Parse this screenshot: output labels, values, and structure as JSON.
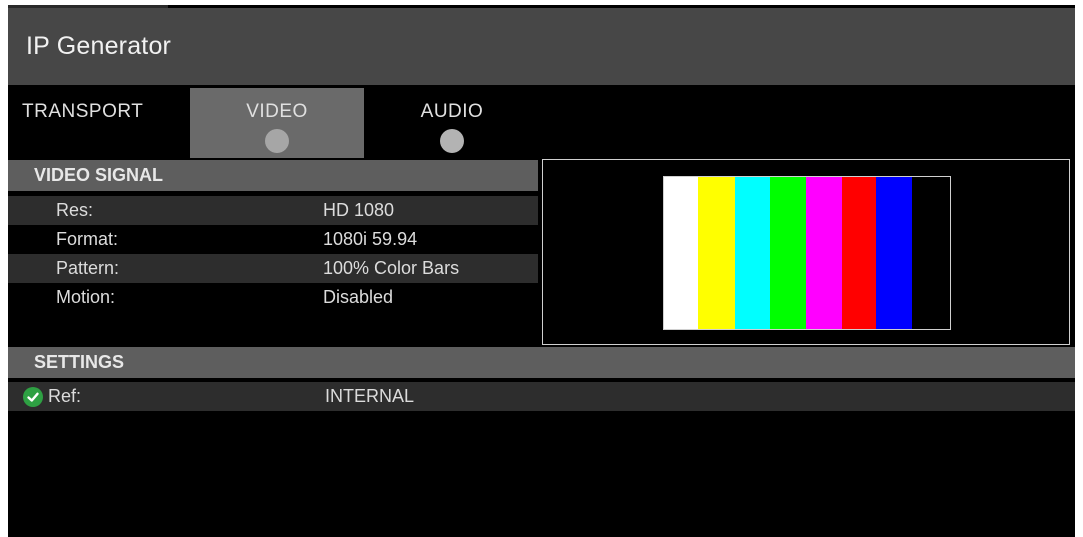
{
  "window": {
    "title": "IP Generator"
  },
  "tabs": [
    {
      "label": "TRANSPORT",
      "active": false,
      "has_indicator": false
    },
    {
      "label": "VIDEO",
      "active": true,
      "has_indicator": true
    },
    {
      "label": "AUDIO",
      "active": false,
      "has_indicator": true
    }
  ],
  "video_signal": {
    "header": "VIDEO SIGNAL",
    "rows": [
      {
        "label": "Res:",
        "value": "HD 1080"
      },
      {
        "label": "Format:",
        "value": "1080i 59.94"
      },
      {
        "label": "Pattern:",
        "value": "100% Color Bars"
      },
      {
        "label": "Motion:",
        "value": "Disabled"
      }
    ]
  },
  "preview": {
    "pattern_name": "color-bars",
    "bar_colors": [
      "#ffffff",
      "#ffff00",
      "#00ffff",
      "#00ff00",
      "#ff00ff",
      "#ff0000",
      "#0000ff",
      "#000000"
    ]
  },
  "settings": {
    "header": "SETTINGS",
    "rows": [
      {
        "label": "Ref:",
        "value": "INTERNAL",
        "status_icon": "check-circle-icon",
        "status_color": "#2ea043"
      }
    ]
  },
  "colors": {
    "titlebar": "#474747",
    "active_tab": "#6a6a6a",
    "section_header": "#5e5e5e",
    "row_stripe": "#2d2d2d",
    "background": "#000000"
  }
}
